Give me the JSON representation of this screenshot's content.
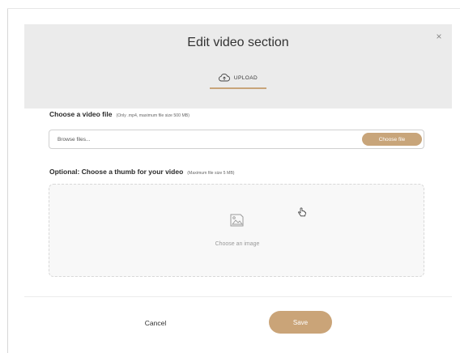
{
  "modal": {
    "title": "Edit video section",
    "close_glyph": "×",
    "tabs": [
      {
        "label": "UPLOAD",
        "icon": "cloud-upload-icon",
        "active": true
      }
    ]
  },
  "video_file": {
    "label": "Choose a video file",
    "hint": "(Only .mp4, maximum file size 500 MB)",
    "input_placeholder": "Browse files...",
    "button_label": "Choose file"
  },
  "thumb": {
    "label": "Optional: Choose a thumb for your video",
    "hint": "(Maximum file size 5 MB)",
    "dropzone_text": "Choose an image",
    "icon": "image-icon"
  },
  "footer": {
    "cancel_label": "Cancel",
    "save_label": "Save"
  },
  "colors": {
    "accent": "#c8a57a",
    "header_bg": "#ebebeb",
    "dropzone_bg": "#f8f8f8"
  }
}
